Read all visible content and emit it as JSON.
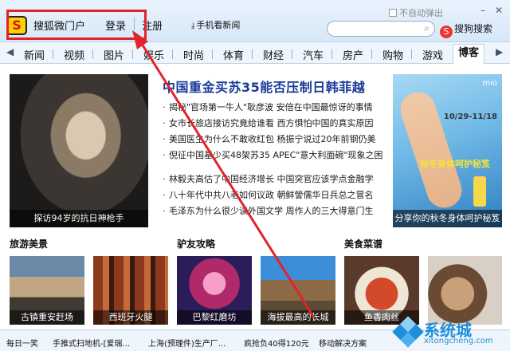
{
  "header": {
    "brand": "搜狐微门户",
    "login": "登录",
    "register": "注册",
    "mobile_news": "手机看新闻",
    "auto_popup": "不自动弹出",
    "search_engine": "搜狗搜索"
  },
  "nav": {
    "items": [
      "新闻",
      "视频",
      "图片",
      "娱乐",
      "时尚",
      "体育",
      "财经",
      "汽车",
      "房产",
      "购物",
      "游戏",
      "博客"
    ],
    "active_index": 11
  },
  "feature": {
    "photo_caption": "探访94岁的抗日神枪手",
    "headline": "中国重金买苏35能否压制日韩菲越",
    "news_group_1": [
      "揭秘\"官场第一牛人\"耿彦波 安倍在中国最惊讶的事情",
      "女市长旅店接访究竟给谁看 西方惧怕中国的真实原因",
      "美国医生为什么不敢收红包 杨振宁说过20年前钢仍美",
      "倪征中国基少买48架苏35 APEC\"意大利面碗\"现象之困"
    ],
    "news_group_2": [
      "林毅夫高估了中国经济增长 中国突官应该学点金融学",
      "八十年代中共八老如何议政 朝鲜謍儒华日兵总之冒名",
      "毛泽东为什么很少读外国文学 周作人的三大得意门生"
    ]
  },
  "ad": {
    "brand": "mio",
    "date": "10/29-11/18",
    "slogan": "秋冬身体呵护秘笈",
    "caption": "分享你的秋冬身体呵护秘笈"
  },
  "sections": [
    {
      "title": "旅游美景"
    },
    {
      "title": "驴友攻略"
    },
    {
      "title": "美食菜谱"
    }
  ],
  "thumbs": [
    {
      "caption": "古镇重安赶场"
    },
    {
      "caption": "西班牙火腿"
    },
    {
      "caption": "巴黎红磨坊"
    },
    {
      "caption": "海拔最高的长城"
    },
    {
      "caption": "鱼香肉丝"
    },
    {
      "caption": ""
    }
  ],
  "ticker": [
    "每日一笑",
    "手推式扫地机-[爱瑞...",
    "上海(预理件)生产厂...",
    "疯抢负40得120元",
    "移动解决方案"
  ],
  "watermark": {
    "name": "系统城",
    "url": "xitongcheng.com"
  },
  "colors": {
    "annotation": "#e3232a",
    "headline": "#1a3a9a",
    "nav_bg": "#eef5fc"
  }
}
